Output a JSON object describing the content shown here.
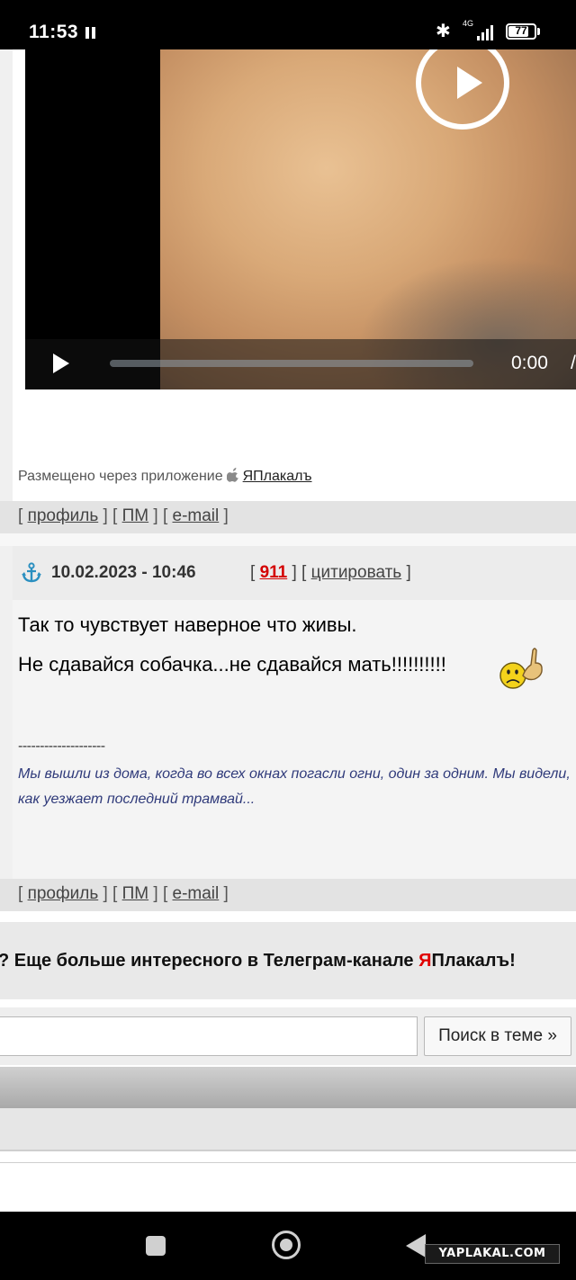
{
  "status_bar": {
    "time": "11:53",
    "network": "4G",
    "battery": "77"
  },
  "video": {
    "time": "0:00",
    "time_sep": "/"
  },
  "previous_post": {
    "via_label": "Размещено через приложение",
    "via_app": "ЯПлакалъ",
    "links": [
      "профиль",
      "ПМ",
      "e-mail"
    ]
  },
  "post": {
    "date": "10.02.2023 - 10:46",
    "number": "911",
    "quote_label": "цитировать",
    "lines": [
      "Так то чувствует наверное что живы.",
      "Не сдавайся собачка...не сдавайся мать!!!!!!!!!!"
    ],
    "signature_separator": "--------------------",
    "signature": "Мы вышли из дома, когда во всех окнах погасли огни, один за одним. Мы видели, как уезжает последний трамвай...",
    "links": [
      "профиль",
      "ПМ",
      "e-mail"
    ]
  },
  "telegram_banner": {
    "prefix": "? Еще больше интересного в Телеграм-канале ",
    "brand_red": "Я",
    "brand_rest": "Плакалъ",
    "suffix": "!"
  },
  "search": {
    "value": "",
    "button_label": "Поиск в теме »"
  },
  "watermark": "YAPLAKAL.COM",
  "colors": {
    "number_red": "#d40000",
    "signature_blue": "#2f3a7a"
  }
}
